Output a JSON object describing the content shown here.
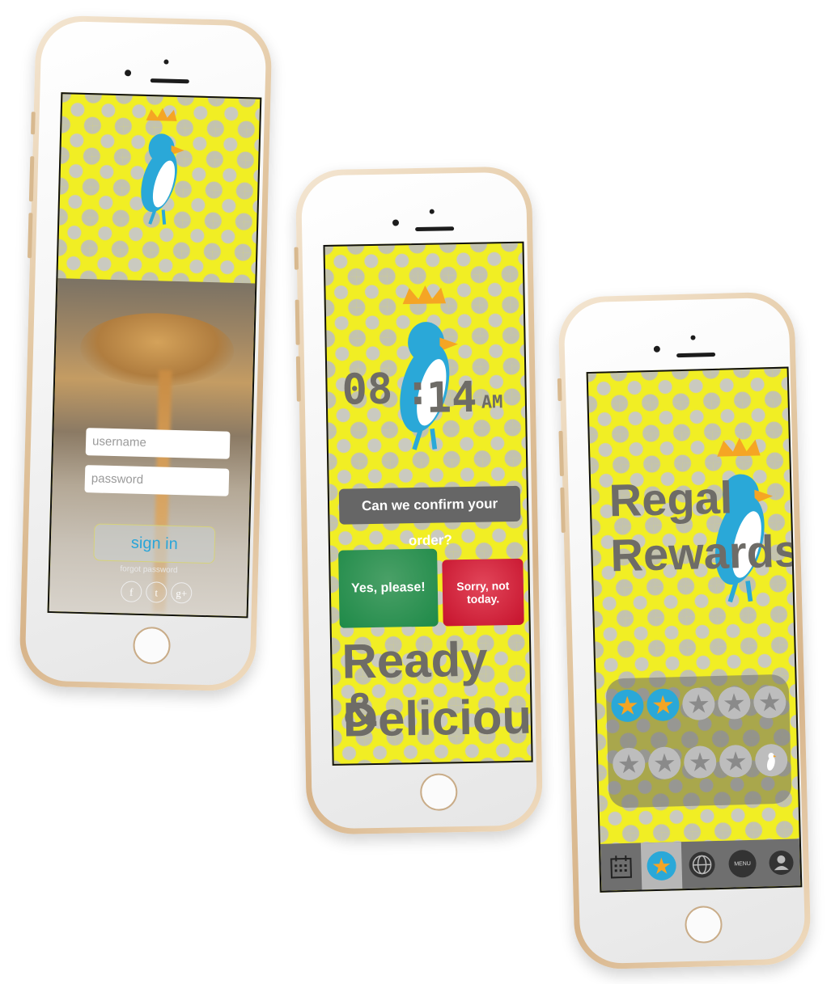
{
  "login": {
    "username_placeholder": "username",
    "password_placeholder": "password",
    "signin_label": "sign in",
    "forgot_label": "forgot password",
    "social": [
      "f",
      "t",
      "g+"
    ]
  },
  "order": {
    "time_hours": "08",
    "time_sep": ":",
    "time_minutes": "14",
    "time_ampm": "AM",
    "question": "Can we confirm your order?",
    "yes_label": "Yes, please!",
    "no_label": "Sorry, not today.",
    "headline_line1": "Ready &",
    "headline_line2": "Delicious"
  },
  "rewards": {
    "title_line1": "Regal",
    "title_line2": "Rewards",
    "stars_earned": 2,
    "stars_total": 10,
    "nav": [
      {
        "name": "calendar-icon",
        "label": ""
      },
      {
        "name": "star-icon",
        "label": ""
      },
      {
        "name": "globe-icon",
        "label": ""
      },
      {
        "name": "menu-icon",
        "label": "MENU"
      },
      {
        "name": "profile-icon",
        "label": ""
      }
    ]
  },
  "colors": {
    "accent_blue": "#2aa8d8",
    "crown_orange": "#f5a524",
    "yes_green": "#2e9b4f",
    "no_red": "#d8263c",
    "pattern_yellow": "#f1ee24"
  }
}
